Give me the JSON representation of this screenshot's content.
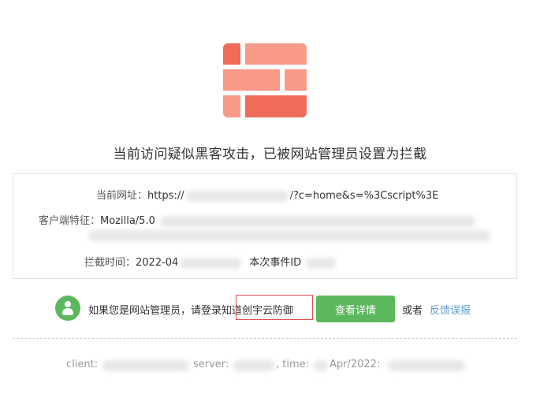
{
  "colors": {
    "logo_light": "#f89a87",
    "logo_dark": "#ef6b5a",
    "accent_green": "#5cb85c",
    "link_blue": "#5b9bd5",
    "highlight_red": "#d9534f"
  },
  "icons": {
    "logo": "firewall-brick-icon",
    "user": "user-icon"
  },
  "title": "当前访问疑似黑客攻击，已被网站管理员设置为拦截",
  "info": {
    "url_label": "当前网址：",
    "url_prefix": "https://",
    "url_suffix": "/?c=home&s=%3Cscript%3E",
    "ua_label": "客户端特征：",
    "ua_prefix": "Mozilla/5.0",
    "time_label": "拦截时间：",
    "time_prefix": "2022-04",
    "event_label": "本次事件ID"
  },
  "admin": {
    "text": "如果您是网站管理员，请登录知道创宇云防御",
    "detail_button": "查看详情",
    "or": "或者",
    "feedback": "反馈误报"
  },
  "footer": {
    "client_label": "client:",
    "server_label": "server:",
    "time_label": ", time:",
    "time_value": "Apr/2022:"
  }
}
